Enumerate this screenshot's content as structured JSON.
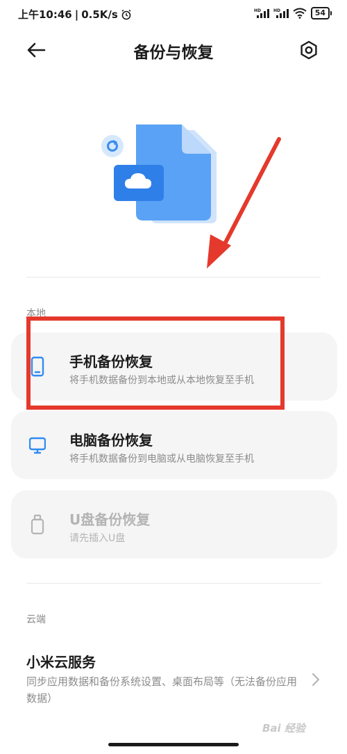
{
  "status_bar": {
    "time": "上午10:46",
    "speed": "0.5K/s",
    "battery": "54"
  },
  "header": {
    "title": "备份与恢复"
  },
  "local": {
    "section_label": "本地",
    "items": [
      {
        "title": "手机备份恢复",
        "subtitle": "将手机数据备份到本地或从本地恢复至手机",
        "icon": "phone-icon"
      },
      {
        "title": "电脑备份恢复",
        "subtitle": "将手机数据备份到电脑或从电脑恢复至手机",
        "icon": "monitor-icon"
      },
      {
        "title": "U盘备份恢复",
        "subtitle": "请先插入U盘",
        "icon": "usb-drive-icon"
      }
    ]
  },
  "cloud": {
    "section_label": "云端",
    "title": "小米云服务",
    "subtitle": "同步应用数据和备份系统设置、桌面布局等（无法备份应用数据）"
  },
  "watermark": "Bai 经验",
  "colors": {
    "accent_blue": "#2f8bf3",
    "annotation_red": "#e4392c",
    "card_bg": "#f5f5f5"
  }
}
